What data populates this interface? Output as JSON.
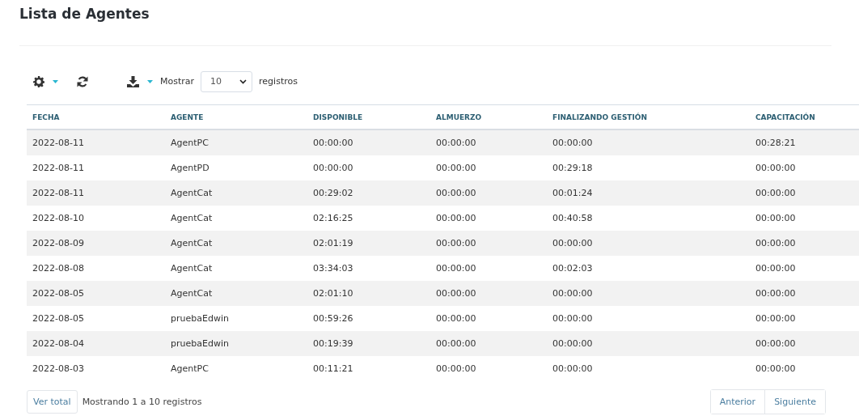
{
  "title": "Lista de Agentes",
  "toolbar": {
    "show_label": "Mostrar",
    "page_size": "10",
    "records_label": "registros"
  },
  "table": {
    "columns": [
      "FECHA",
      "AGENTE",
      "DISPONIBLE",
      "ALMUERZO",
      "FINALIZANDO GESTIÓN",
      "CAPACITACIÓN"
    ],
    "rows": [
      [
        "2022-08-11",
        "AgentPC",
        "00:00:00",
        "00:00:00",
        "00:00:00",
        "00:28:21"
      ],
      [
        "2022-08-11",
        "AgentPD",
        "00:00:00",
        "00:00:00",
        "00:29:18",
        "00:00:00"
      ],
      [
        "2022-08-11",
        "AgentCat",
        "00:29:02",
        "00:00:00",
        "00:01:24",
        "00:00:00"
      ],
      [
        "2022-08-10",
        "AgentCat",
        "02:16:25",
        "00:00:00",
        "00:40:58",
        "00:00:00"
      ],
      [
        "2022-08-09",
        "AgentCat",
        "02:01:19",
        "00:00:00",
        "00:00:00",
        "00:00:00"
      ],
      [
        "2022-08-08",
        "AgentCat",
        "03:34:03",
        "00:00:00",
        "00:02:03",
        "00:00:00"
      ],
      [
        "2022-08-05",
        "AgentCat",
        "02:01:10",
        "00:00:00",
        "00:00:00",
        "00:00:00"
      ],
      [
        "2022-08-05",
        "pruebaEdwin",
        "00:59:26",
        "00:00:00",
        "00:00:00",
        "00:00:00"
      ],
      [
        "2022-08-04",
        "pruebaEdwin",
        "00:19:39",
        "00:00:00",
        "00:00:00",
        "00:00:00"
      ],
      [
        "2022-08-03",
        "AgentPC",
        "00:11:21",
        "00:00:00",
        "00:00:00",
        "00:00:00"
      ]
    ]
  },
  "footer": {
    "total_button": "Ver total",
    "info": "Mostrando 1 a 10 registros",
    "pagination": [
      "Anterior",
      "Siguiente"
    ]
  }
}
